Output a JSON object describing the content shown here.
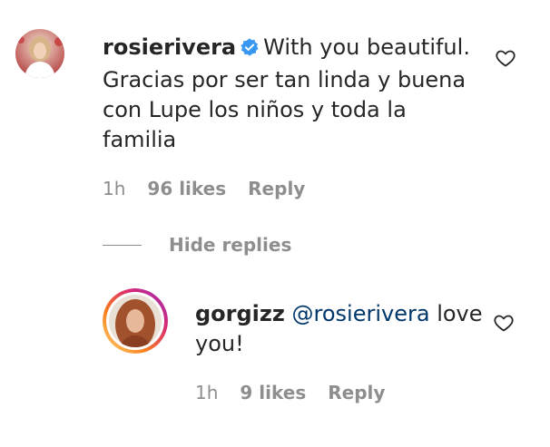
{
  "comments": [
    {
      "username": "rosierivera",
      "verified": true,
      "text": "With you beautiful. Gracias por ser tan linda y buena con Lupe los niños y toda la familia",
      "time": "1h",
      "likes": "96 likes",
      "reply_label": "Reply"
    }
  ],
  "replies_toggle": {
    "label": "Hide replies"
  },
  "replies": [
    {
      "username": "gorgizz",
      "mention": "@rosierivera",
      "text": "love you!",
      "time": "1h",
      "likes": "9 likes",
      "reply_label": "Reply"
    }
  ],
  "colors": {
    "text": "#262626",
    "muted": "#8e8e8e",
    "mention": "#00376b",
    "verified": "#3897f0",
    "story_ring_start": "#feda75",
    "story_ring_end": "#d62976"
  },
  "icons": {
    "verified": "verified-badge-icon",
    "like": "heart-outline-icon"
  }
}
